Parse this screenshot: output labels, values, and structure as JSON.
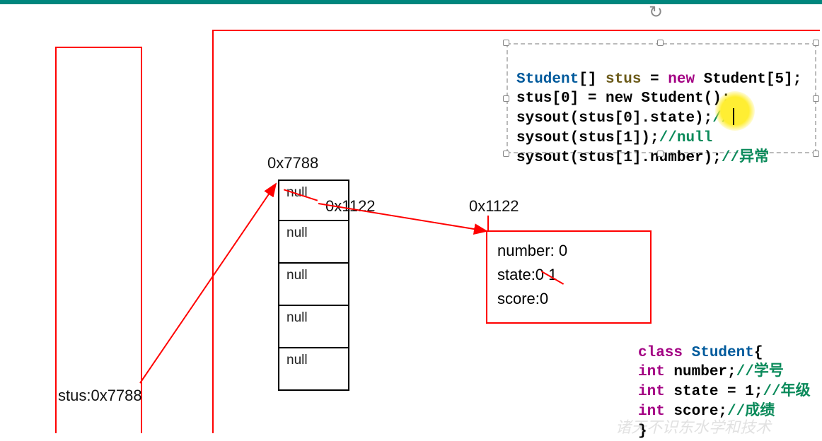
{
  "topbar": {},
  "refresh_icon": "↻",
  "stack": {
    "var_label": "stus:0x7788"
  },
  "heap": {
    "array_addr": "0x7788",
    "cells": [
      "null",
      "null",
      "null",
      "null",
      "null"
    ],
    "cell0_override_addr": "0x1122",
    "object_addr": "0x1122",
    "object": {
      "number": "number: 0",
      "state": "state:0   1",
      "score": "score:0"
    }
  },
  "code_top": {
    "line1": {
      "ty": "Student",
      "brackets": "[] ",
      "var": "stus",
      "eq": " = ",
      "kw": "new",
      "rest": " Student[5];"
    },
    "line2": "stus[0] = new Student();",
    "line3": {
      "pre": "sysout(stus[0].state);",
      "com": "//1"
    },
    "line4": {
      "pre": "sysout(stus[1]);",
      "com": "//null"
    },
    "line5": {
      "pre": "sysout(stus[1].number);",
      "com": "//异常"
    }
  },
  "code_bottom": {
    "line1": {
      "kw": "class",
      "sp": " ",
      "ty": "Student",
      "rest": "{"
    },
    "line2": {
      "kw": "int",
      "sp": " ",
      "name": "number;",
      "com": "//学号"
    },
    "line3": {
      "kw": "int",
      "sp": " ",
      "name": "state = 1;",
      "com": "//年级"
    },
    "line4": {
      "kw": "int",
      "sp": " ",
      "name": "score;",
      "com": "//成绩"
    },
    "line5": "}"
  },
  "watermark": "诸天不识东水学和技术"
}
